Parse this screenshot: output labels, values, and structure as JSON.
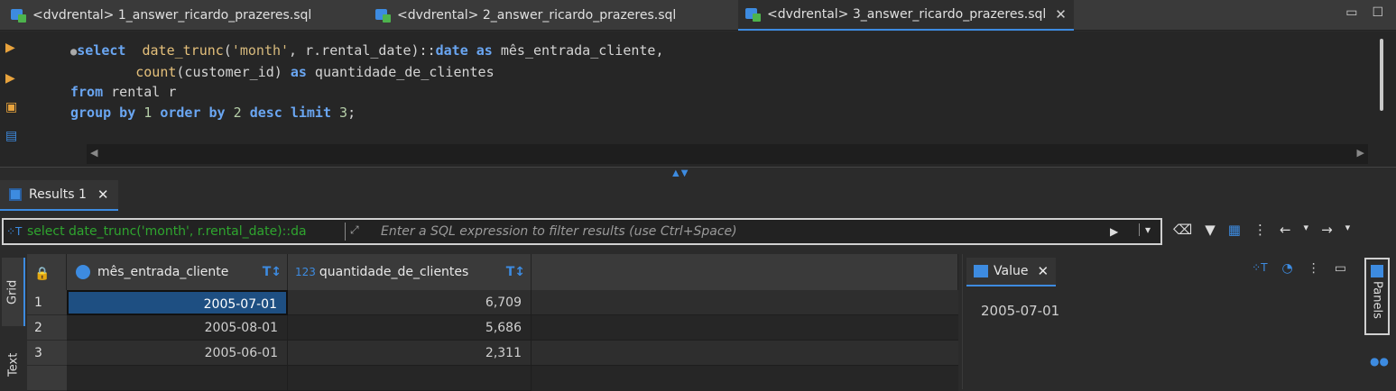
{
  "editor_tabs": [
    {
      "label": "<dvdrental> 1_answer_ricardo_prazeres.sql",
      "active": false
    },
    {
      "label": "<dvdrental> 2_answer_ricardo_prazeres.sql",
      "active": false
    },
    {
      "label": "<dvdrental> 3_answer_ricardo_prazeres.sql",
      "active": true
    }
  ],
  "window_controls": {
    "minimize": "▭",
    "maximize": "☐"
  },
  "close_glyph": "✕",
  "gutter_icons": [
    {
      "name": "execute-statement-icon",
      "glyph": "▶",
      "color": "#e8a33d"
    },
    {
      "name": "execute-in-new-tab-icon",
      "glyph": "▶",
      "color": "#e8a33d"
    },
    {
      "name": "execute-script-icon",
      "glyph": "▣",
      "color": "#e8a33d"
    },
    {
      "name": "explain-plan-icon",
      "glyph": "▤",
      "color": "#3d8be0"
    }
  ],
  "sql": {
    "line1": {
      "kw1": "select",
      "sp1": "  ",
      "fn1": "date_trunc",
      "p1": "(",
      "str1": "'month'",
      "rest": ", r.rental_date)::",
      "kw2": "date",
      "sp2": " ",
      "kw3": "as",
      "alias": " mês_entrada_cliente,"
    },
    "line2": {
      "indent": "        ",
      "fn": "count",
      "rest": "(customer_id) ",
      "kw": "as",
      "alias": " quantidade_de_clientes"
    },
    "line3": {
      "kw": "from",
      "rest": " rental r"
    },
    "line4": {
      "kw1": "group by",
      "n1": " 1 ",
      "kw2": "order by",
      "n2": " 2 ",
      "kw3": "desc",
      "kw4": " limit",
      "n3": " 3",
      "end": ";"
    }
  },
  "results": {
    "tab_label": "Results 1",
    "filter": {
      "current_query": "select date_trunc('month', r.rental_date)::da",
      "placeholder": "Enter a SQL expression to filter results (use Ctrl+Space)"
    },
    "side_tabs": {
      "grid": "Grid",
      "text": "Text"
    },
    "columns": [
      {
        "type_badge": "clock",
        "name": "mês_entrada_cliente"
      },
      {
        "type_badge": "123",
        "name": "quantidade_de_clientes"
      }
    ],
    "rows": [
      {
        "n": "1",
        "month": "2005-07-01",
        "count": "6,709"
      },
      {
        "n": "2",
        "month": "2005-08-01",
        "count": "5,686"
      },
      {
        "n": "3",
        "month": "2005-06-01",
        "count": "2,311"
      }
    ],
    "selected_cell": {
      "row": 1,
      "column": "mês_entrada_cliente"
    }
  },
  "value_panel": {
    "tab_label": "Value",
    "content": "2005-07-01"
  },
  "panels_strip": {
    "label": "Panels"
  },
  "colors": {
    "accent": "#3d8be0",
    "keyword": "#6aa6f2",
    "string": "#d7ba7d",
    "filter_text": "#2fa52f"
  }
}
